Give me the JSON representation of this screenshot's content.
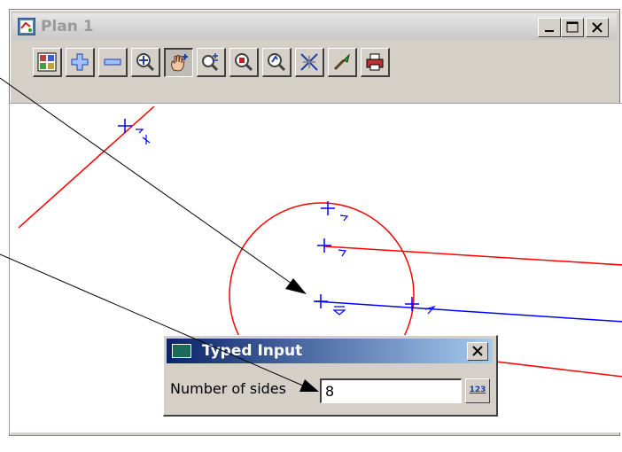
{
  "window": {
    "title": "Plan 1",
    "controls": [
      "minimize",
      "maximize",
      "close"
    ]
  },
  "toolbar": {
    "buttons": [
      {
        "icon": "plot-icon"
      },
      {
        "icon": "zoom-in-icon"
      },
      {
        "icon": "zoom-out-icon"
      },
      {
        "icon": "zoom-fit-icon"
      },
      {
        "icon": "pan-hand-icon",
        "active": true
      },
      {
        "icon": "zoom-scale-icon"
      },
      {
        "icon": "zoom-window-icon"
      },
      {
        "icon": "zoom-previous-icon"
      },
      {
        "icon": "cursor-snap-icon"
      },
      {
        "icon": "pick-icon"
      },
      {
        "icon": "print-icon"
      }
    ]
  },
  "dialog": {
    "title": "Typed Input",
    "field_label": "Number of sides",
    "field_value": "8",
    "calculator_label": "123"
  },
  "colors": {
    "red_line": "#ff0000",
    "blue_line": "#0000ff",
    "dialog_title_start": "#0a246a",
    "dialog_title_end": "#a6caf0"
  }
}
